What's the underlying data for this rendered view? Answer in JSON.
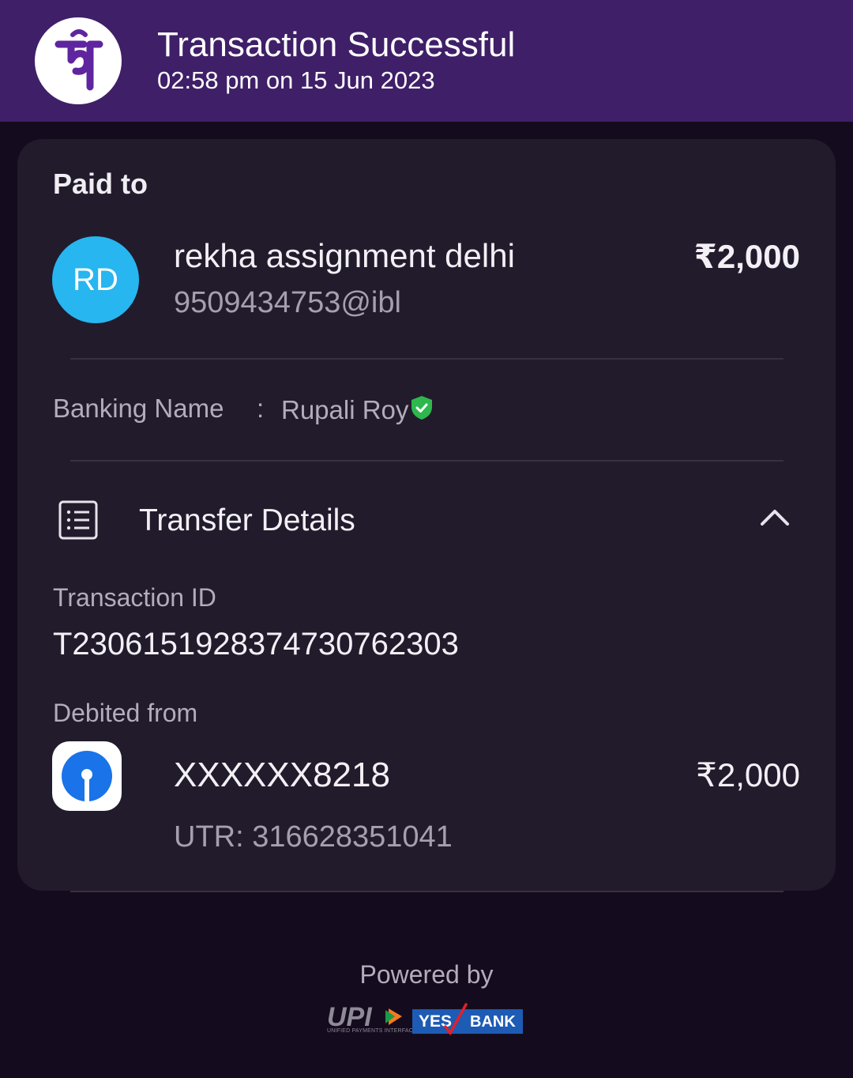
{
  "header": {
    "title": "Transaction Successful",
    "datetime": "02:58 pm on 15 Jun 2023",
    "logo": "phonepe-logo"
  },
  "paid_to": {
    "section_label": "Paid to",
    "avatar_initials": "RD",
    "payee_name": "rekha assignment delhi",
    "upi_id": "9509434753@ibl",
    "amount": "₹2,000"
  },
  "banking_name": {
    "label": "Banking Name",
    "separator": ":",
    "value": "Rupali Roy",
    "verified_icon": "verified-shield-icon"
  },
  "transfer_details": {
    "title": "Transfer Details",
    "icon": "document-list-icon",
    "expand_icon": "chevron-up-icon",
    "transaction_id_label": "Transaction ID",
    "transaction_id": "T2306151928374730762303",
    "debited_from_label": "Debited from",
    "account": "XXXXXX8218",
    "debit_amount": "₹2,000",
    "utr": "UTR: 316628351041",
    "bank_icon": "sbi-logo"
  },
  "footer": {
    "powered_by": "Powered by",
    "upi_logo_text": "UPI",
    "upi_subtext": "UNIFIED PAYMENTS INTERFACE",
    "partner_bank_yes": "YES",
    "partner_bank_bank": "BANK"
  },
  "colors": {
    "header_bg": "#3f1f68",
    "page_bg": "#140c1e",
    "card_bg": "#221b2c",
    "avatar_bg": "#27b6ef",
    "verified_green": "#2db84d",
    "phonepe_purple": "#5f259f",
    "sbi_blue": "#1a73e8",
    "yes_bank_blue": "#1d5bb4"
  }
}
